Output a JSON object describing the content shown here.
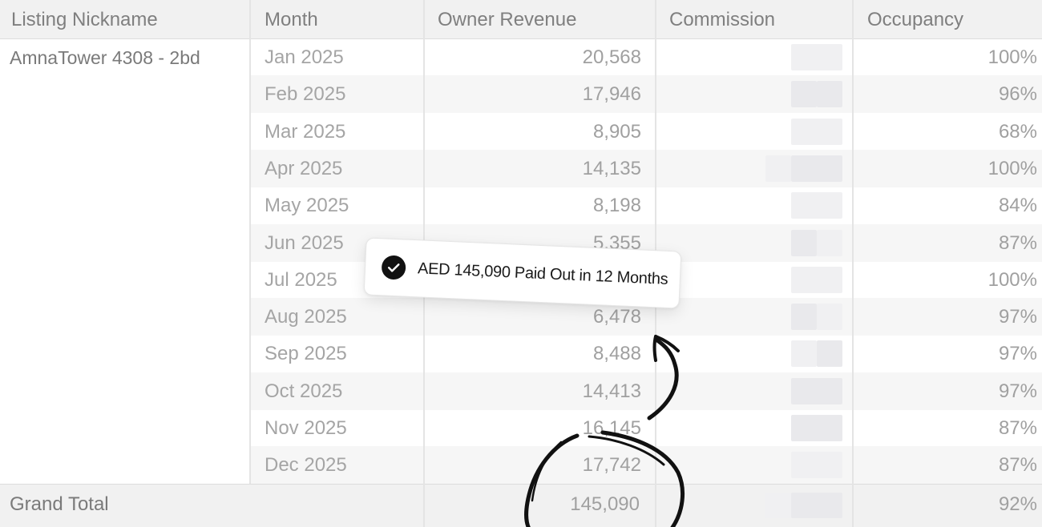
{
  "columns": {
    "listing": "Listing Nickname",
    "month": "Month",
    "revenue": "Owner Revenue",
    "commission": "Commission",
    "occupancy": "Occupancy"
  },
  "listing_name": "AmnaTower 4308 - 2bd",
  "rows": [
    {
      "month": "Jan 2025",
      "revenue": "20,568",
      "occupancy": "100%"
    },
    {
      "month": "Feb 2025",
      "revenue": "17,946",
      "occupancy": "96%"
    },
    {
      "month": "Mar 2025",
      "revenue": "8,905",
      "occupancy": "68%"
    },
    {
      "month": "Apr 2025",
      "revenue": "14,135",
      "occupancy": "100%"
    },
    {
      "month": "May 2025",
      "revenue": "8,198",
      "occupancy": "84%"
    },
    {
      "month": "Jun 2025",
      "revenue": "5,355",
      "occupancy": "87%"
    },
    {
      "month": "Jul 2025",
      "revenue": "",
      "occupancy": "100%"
    },
    {
      "month": "Aug 2025",
      "revenue": "6,478",
      "occupancy": "97%"
    },
    {
      "month": "Sep 2025",
      "revenue": "8,488",
      "occupancy": "97%"
    },
    {
      "month": "Oct 2025",
      "revenue": "14,413",
      "occupancy": "97%"
    },
    {
      "month": "Nov 2025",
      "revenue": "16,145",
      "occupancy": "87%"
    },
    {
      "month": "Dec 2025",
      "revenue": "17,742",
      "occupancy": "87%"
    }
  ],
  "total": {
    "label": "Grand Total",
    "revenue": "145,090",
    "occupancy": "92%"
  },
  "toast": {
    "text": "AED 145,090 Paid Out in 12 Months",
    "icon": "check-circle-icon"
  },
  "colors": {
    "header_bg": "#f1f1f1",
    "toast_icon": "#111111"
  }
}
